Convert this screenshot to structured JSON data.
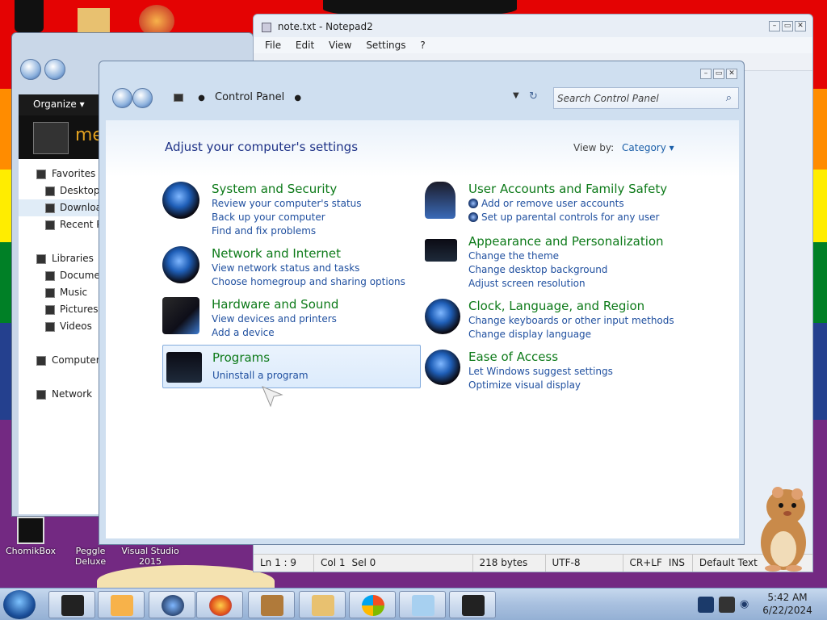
{
  "desktop": {
    "icons": [
      {
        "label": "ChomikBox"
      },
      {
        "label": "Peggle Deluxe"
      },
      {
        "label": "Visual Studio 2015"
      }
    ]
  },
  "explorer": {
    "organize_label": "Organize",
    "banner_text": "me",
    "tree": [
      {
        "label": "Favorites",
        "level": "top"
      },
      {
        "label": "Desktop",
        "level": "sub"
      },
      {
        "label": "Downloads",
        "level": "sub",
        "selected": true
      },
      {
        "label": "Recent Places",
        "level": "sub"
      },
      {
        "label": "",
        "level": "gap"
      },
      {
        "label": "Libraries",
        "level": "top"
      },
      {
        "label": "Documents",
        "level": "sub"
      },
      {
        "label": "Music",
        "level": "sub"
      },
      {
        "label": "Pictures",
        "level": "sub"
      },
      {
        "label": "Videos",
        "level": "sub"
      },
      {
        "label": "",
        "level": "gap"
      },
      {
        "label": "Computer",
        "level": "top"
      },
      {
        "label": "",
        "level": "gap"
      },
      {
        "label": "Network",
        "level": "top"
      }
    ]
  },
  "notepad": {
    "title": "note.txt - Notepad2",
    "menu": [
      "File",
      "Edit",
      "View",
      "Settings",
      "?"
    ],
    "status": {
      "position": "Ln 1 : 9",
      "col": "Col 1",
      "sel": "Sel 0",
      "size": "218 bytes",
      "encoding": "UTF-8",
      "eol": "CR+LF",
      "ins": "INS",
      "scheme": "Default Text"
    }
  },
  "control_panel": {
    "breadcrumb": "Control Panel",
    "search_placeholder": "Search Control Panel",
    "heading": "Adjust your computer's settings",
    "view_by_label": "View by:",
    "view_by_value": "Category",
    "left": [
      {
        "title": "System and Security",
        "icon": "system-security-icon",
        "links": [
          "Review your computer's status",
          "Back up your computer",
          "Find and fix problems"
        ]
      },
      {
        "title": "Network and Internet",
        "icon": "network-internet-icon",
        "links": [
          "View network status and tasks",
          "Choose homegroup and sharing options"
        ]
      },
      {
        "title": "Hardware and Sound",
        "icon": "hardware-sound-icon",
        "links": [
          "View devices and printers",
          "Add a device"
        ]
      },
      {
        "title": "Programs",
        "icon": "programs-icon",
        "highlighted": true,
        "links": [
          "Uninstall a program"
        ]
      }
    ],
    "right": [
      {
        "title": "User Accounts and Family Safety",
        "icon": "user-accounts-icon",
        "links": [
          "Add or remove user accounts",
          "Set up parental controls for any user"
        ]
      },
      {
        "title": "Appearance and Personalization",
        "icon": "appearance-icon",
        "links": [
          "Change the theme",
          "Change desktop background",
          "Adjust screen resolution"
        ]
      },
      {
        "title": "Clock, Language, and Region",
        "icon": "clock-region-icon",
        "links": [
          "Change keyboards or other input methods",
          "Change display language"
        ]
      },
      {
        "title": "Ease of Access",
        "icon": "ease-of-access-icon",
        "links": [
          "Let Windows suggest settings",
          "Optimize visual display"
        ]
      }
    ]
  },
  "taskbar": {
    "time": "5:42 AM",
    "date": "6/22/2024",
    "buttons": [
      "app-1",
      "media-player",
      "globe-app",
      "firefox",
      "chomikbox",
      "explorer-folder",
      "windows-logo",
      "notepad",
      "control-panel"
    ]
  }
}
